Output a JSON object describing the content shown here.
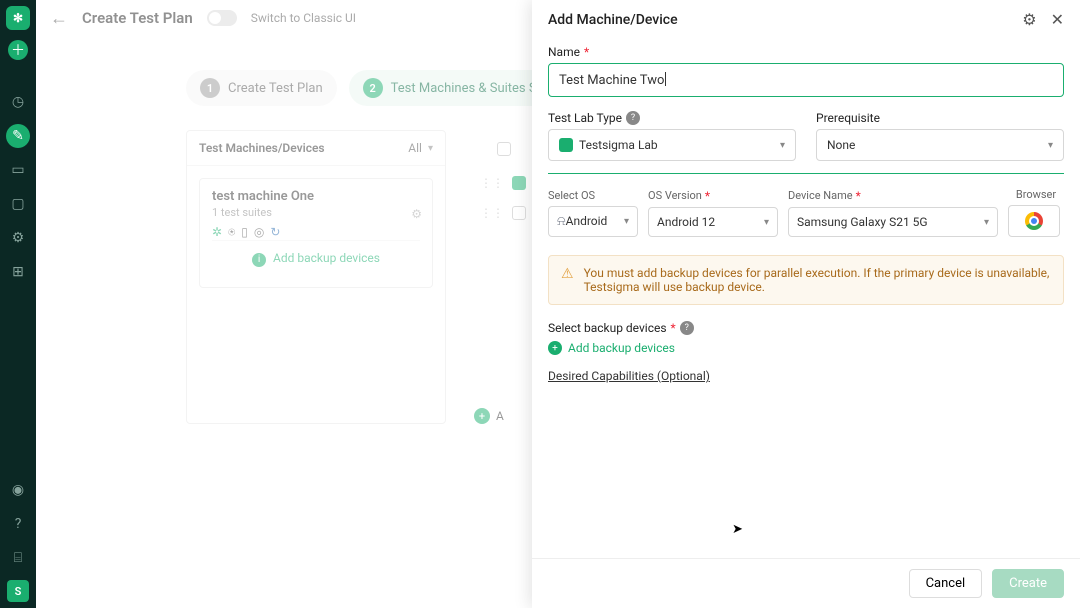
{
  "header": {
    "title": "Create Test Plan",
    "switch_label": "Switch to Classic UI"
  },
  "stepper": {
    "step1": "Create Test Plan",
    "step2": "Test Machines & Suites Selection"
  },
  "left_panel": {
    "title": "Test Machines/Devices",
    "filter": "All",
    "machine": {
      "name": "test machine One",
      "sub": "1 test suites"
    },
    "add_backup": "Add backup devices"
  },
  "mid": {
    "bottom_add": "A"
  },
  "drawer": {
    "title": "Add Machine/Device",
    "name_label": "Name",
    "name_value": "Test Machine Two",
    "lab_label": "Test Lab Type",
    "lab_value": "Testsigma Lab",
    "prereq_label": "Prerequisite",
    "prereq_value": "None",
    "os_label": "Select OS",
    "os_value": "Android",
    "osver_label": "OS Version",
    "osver_value": "Android 12",
    "device_label": "Device Name",
    "device_value": "Samsung Galaxy S21 5G",
    "browser_label": "Browser",
    "warn_text": "You must add backup devices for parallel execution. If the primary device is unavailable, Testsigma will use backup device.",
    "backup_section_label": "Select backup devices",
    "add_backup": "Add backup devices",
    "caps_link": "Desired Capabilities (Optional)",
    "cancel": "Cancel",
    "create": "Create"
  }
}
